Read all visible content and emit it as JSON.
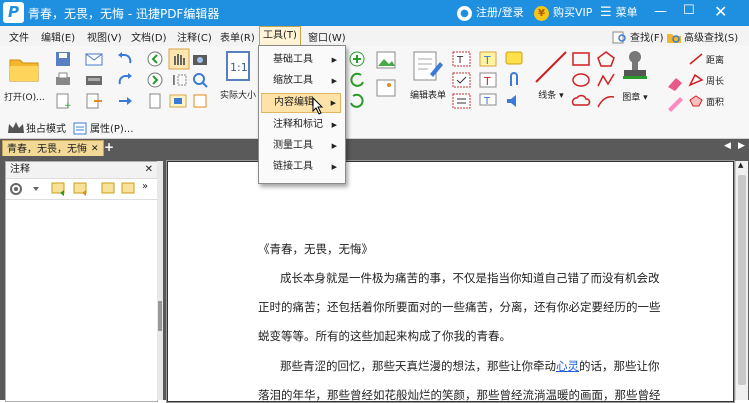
{
  "titlebar": {
    "title": "青春，无畏，无悔 - 迅捷PDF编辑器",
    "login": "注册/登录",
    "buy_vip": "购买VIP",
    "menu": "菜单"
  },
  "menubar": {
    "items": [
      "文件",
      "编辑(E)",
      "视图(V)",
      "文档(D)",
      "注释(C)",
      "表单(R)",
      "工具(T)",
      "窗口(W)"
    ],
    "active_index": 6
  },
  "ribbon": {
    "open": "打开(O)...",
    "actual_size": "实际大小",
    "edit_form": "编辑表单",
    "line": "线条",
    "stamp": "图章",
    "find": "查找(F)",
    "advanced_find": "高级查找(S)",
    "distance": "距离",
    "perimeter": "周长",
    "area": "面积"
  },
  "subtoolbar": {
    "exclusive_mode": "独占模式",
    "properties": "属性(P)..."
  },
  "tabs": [
    {
      "label": "青春，无畏，无悔"
    }
  ],
  "panel": {
    "title": "注释"
  },
  "dropdown": {
    "items": [
      {
        "label": "基础工具"
      },
      {
        "label": "缩放工具"
      },
      {
        "label": "内容编辑"
      },
      {
        "label": "注释和标记"
      },
      {
        "label": "测量工具"
      },
      {
        "label": "链接工具"
      }
    ],
    "highlighted_index": 2
  },
  "document": {
    "title": "《青春，无畏，无悔》",
    "p1_line1": "成长本身就是一件极为痛苦的事，不仅是指当你知道自己错了而没有机会改",
    "p1_line2": "正时的痛苦；还包括着你所要面对的一些痛苦，分离，还有你必定要经历的一些",
    "p1_line3": "蜕变等等。所有的这些加起来构成了你我的青春。",
    "p2_line1_pre": "那些青涩的回忆，那些天真烂漫的想法，那些让你牵动",
    "p2_line1_link": "心灵",
    "p2_line1_post": "的话，那些让你",
    "p2_line2": "落泪的年华，那些曾经如花般灿烂的笑颜，那些曾经流淌温暖的画面，那些曾经"
  },
  "colors": {
    "titlebar": "#1f8fe0",
    "tab_active": "#f2d996",
    "workarea": "#5a5a5a",
    "dropdown_highlight": "#fde3a7",
    "link": "#1a5fd8"
  }
}
